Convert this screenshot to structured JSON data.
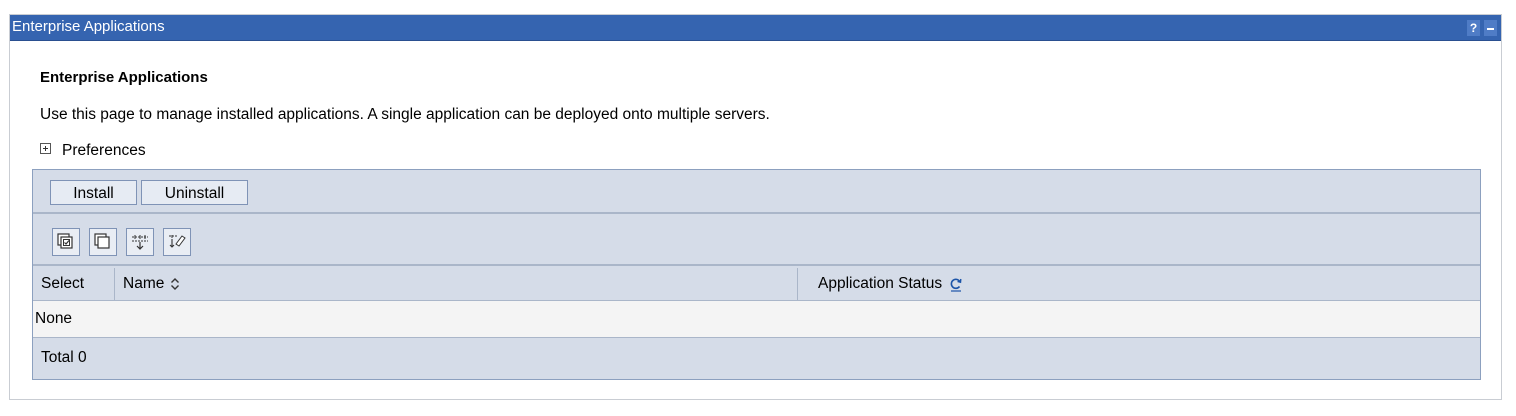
{
  "portlet": {
    "title": "Enterprise Applications",
    "help_label": "?"
  },
  "page": {
    "heading": "Enterprise Applications",
    "description": "Use this page to manage installed applications. A single application can be deployed onto multiple servers.",
    "preferences_label": "Preferences"
  },
  "toolbar": {
    "install_label": "Install",
    "uninstall_label": "Uninstall",
    "icons": [
      "select-all-icon",
      "deselect-all-icon",
      "show-filter-icon",
      "clear-filter-icon"
    ]
  },
  "table": {
    "columns": [
      "Select",
      "Name",
      "Application Status"
    ],
    "empty_text": "None",
    "total_text": "Total 0"
  },
  "colors": {
    "titlebar": "#3564b0",
    "table_bg": "#d5dce8",
    "row_bg": "#f4f4f4"
  }
}
